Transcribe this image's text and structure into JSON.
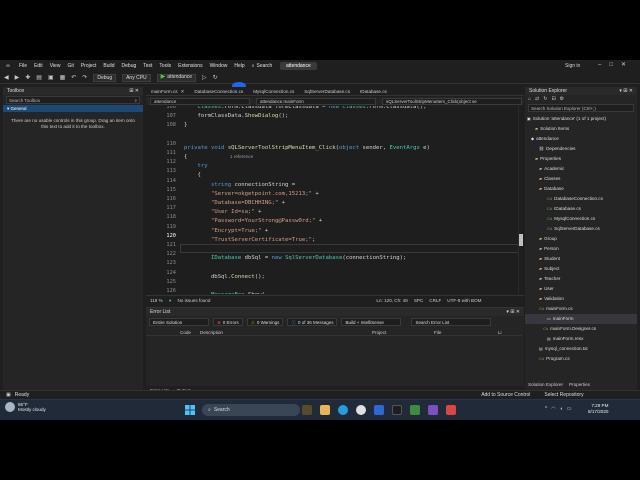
{
  "menu": {
    "items": [
      "File",
      "Edit",
      "View",
      "Git",
      "Project",
      "Build",
      "Debug",
      "Test",
      "Tools",
      "Extensions",
      "Window",
      "Help"
    ],
    "search_label": "Search",
    "project_name": "attendance",
    "sign_in": "Sign in"
  },
  "toolbar": {
    "config": "Debug",
    "platform": "Any CPU",
    "run_target": "attendance"
  },
  "toolbox": {
    "title": "Toolbox",
    "search_placeholder": "Search Toolbox",
    "group": "General",
    "message": "There are no usable controls in this group. Drag an item onto this text to add it to the toolbox."
  },
  "doc_tabs": [
    "mainForm.cs",
    "DatabaseConnection.cs",
    "MysqlConnection.cs",
    "SqlServerDatabase.cs",
    "IDatabase.cs"
  ],
  "nav": {
    "project": "attendance",
    "class": "attendance.mainForm",
    "member": "sQLServerToolStripMenuItem_Click(object se"
  },
  "editor": {
    "line_numbers": [
      "106",
      "107",
      "108",
      "",
      "110",
      "111",
      "112",
      "113",
      "114",
      "115",
      "116",
      "117",
      "118",
      "119",
      "120",
      "121",
      "122",
      "123",
      "124",
      "125",
      "126"
    ],
    "current_line": "120",
    "reference_label": "1 reference",
    "lines": [
      "    Classes.Form.Classdata formClassdata = new Classes.Form.Classdata();",
      "    formClassData.ShowDialog();",
      "}",
      "",
      "private void sQLServerToolStripMenuItem_Click(object sender, EventArgs e)",
      "{",
      "    try",
      "    {",
      "        string connectionString =",
      "        \"Server=okgetpoint.com,15213;\" +",
      "        \"Database=DBCHHING;\" +",
      "        \"User Id=sa;\" +",
      "        \"Password=YourStrong@Passw0rd;\" +",
      "        \"Encrypt=True;\" +",
      "        \"TrustServerCertificate=True;\";",
      "",
      "        IDatabase dbSql = new SqlServerDatabase(connectionString);",
      "",
      "        dbSql.Connect();",
      "",
      "        MessageBox.Show("
    ],
    "partial_line": "            \"SQL Server connected successfully!\""
  },
  "editor_status": {
    "zoom": "119 %",
    "issues": "No issues found",
    "position": "Ln: 120, Ch: 48",
    "indent": "SPC",
    "eol": "CRLF",
    "encoding": "UTF-8 with BOM"
  },
  "error_list": {
    "title": "Error List",
    "scope": "Entire Solution",
    "errors": "0 Errors",
    "warnings": "0 Warnings",
    "messages": "0 of 36 Messages",
    "build": "Build + IntelliSense",
    "search_placeholder": "Search Error List",
    "columns": [
      "Code",
      "Description",
      "Project",
      "File",
      "Li"
    ],
    "bottom_tabs": [
      "Error List",
      "Output"
    ]
  },
  "solution_explorer": {
    "title": "Solution Explorer",
    "search_placeholder": "Search Solution Explorer (Ctrl+;)",
    "items": [
      {
        "label": "Solution 'attendance' (1 of 1 project)",
        "kind": "solution"
      },
      {
        "label": "Solution Items",
        "kind": "folder"
      },
      {
        "label": "attendance",
        "kind": "project"
      },
      {
        "label": "Dependencies",
        "kind": "deps"
      },
      {
        "label": "Properties",
        "kind": "folder"
      },
      {
        "label": "Academic",
        "kind": "folder"
      },
      {
        "label": "Classes",
        "kind": "folder"
      },
      {
        "label": "Database",
        "kind": "folder"
      },
      {
        "label": "DatabaseConnection.cs",
        "kind": "cs"
      },
      {
        "label": "IDatabase.cs",
        "kind": "cs"
      },
      {
        "label": "MysqlConnection.cs",
        "kind": "cs"
      },
      {
        "label": "SqlServerDatabase.cs",
        "kind": "cs"
      },
      {
        "label": "Group",
        "kind": "folder"
      },
      {
        "label": "Person",
        "kind": "folder"
      },
      {
        "label": "Student",
        "kind": "folder"
      },
      {
        "label": "Subject",
        "kind": "folder"
      },
      {
        "label": "Teacher",
        "kind": "folder"
      },
      {
        "label": "User",
        "kind": "folder"
      },
      {
        "label": "Validation",
        "kind": "folder"
      },
      {
        "label": "mainForm.cs",
        "kind": "cs"
      },
      {
        "label": "mainForm",
        "kind": "form"
      },
      {
        "label": "mainForm.Designer.cs",
        "kind": "cs"
      },
      {
        "label": "mainForm.resx",
        "kind": "resx"
      },
      {
        "label": "mysql_connection.txt",
        "kind": "txt"
      },
      {
        "label": "Program.cs",
        "kind": "cs"
      }
    ],
    "bottom_tabs": [
      "Solution Explorer",
      "Properties"
    ]
  },
  "statusbar": {
    "ready": "Ready",
    "source_control": "Add to Source Control",
    "repository": "Select Repository"
  },
  "taskbar": {
    "temperature": "86°F",
    "weather": "Mostly cloudy",
    "search": "Search",
    "time": "7:29 PM",
    "date": "8/17/2020"
  }
}
